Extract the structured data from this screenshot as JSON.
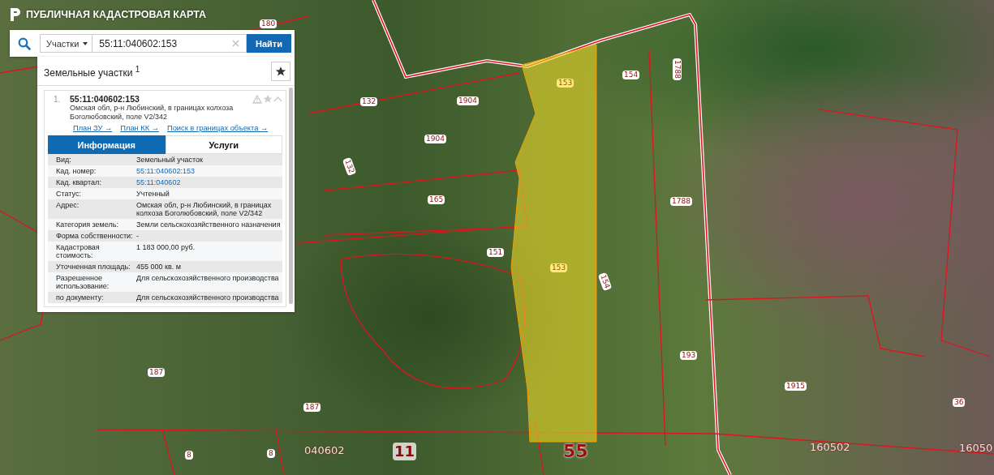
{
  "app_title": "ПУБЛИЧНАЯ КАДАСТРОВАЯ КАРТА",
  "search": {
    "category": "Участки",
    "value": "55:11:040602:153",
    "button": "Найти"
  },
  "results": {
    "title": "Земельные участки $^{1}$",
    "items": [
      {
        "index": "1.",
        "number": "55:11:040602:153",
        "address": "Омская обл, р-н Любинский, в границах колхоза Боголюбовский, поле V2/342",
        "links": [
          "План ЗУ →",
          "План КК →",
          "Поиск в границах объекта →"
        ],
        "tabs": [
          {
            "label": "Информация",
            "selected": true
          },
          {
            "label": "Услуги",
            "selected": false
          }
        ],
        "rows": [
          {
            "label": "Вид:",
            "value": "Земельный участок",
            "kind": "text"
          },
          {
            "label": "Кад. номер:",
            "value": "55:11:040602:153",
            "kind": "link"
          },
          {
            "label": "Кад. квартал:",
            "value": "55:11:040602",
            "kind": "link"
          },
          {
            "label": "Статус:",
            "value": "Учтенный",
            "kind": "text"
          },
          {
            "label": "Адрес:",
            "value": "Омская обл, р-н Любинский, в границах колхоза Боголюбовский, поле V2/342",
            "kind": "text"
          },
          {
            "label": "Категория земель:",
            "value": "Земли сельскохозяйственного назначения",
            "kind": "text"
          },
          {
            "label": "Форма собственности:",
            "value": "-",
            "kind": "text"
          },
          {
            "label": "Кадастровая стоимость:",
            "value": "1 183 000,00 руб.",
            "kind": "text"
          },
          {
            "label": "Уточненная площадь:",
            "value": "455 000 кв. м",
            "kind": "text"
          },
          {
            "label": "Разрешенное использование:",
            "value": "Для сельскохозяйственного производства",
            "kind": "text"
          },
          {
            "label": "по документу:",
            "value": "Для сельскохозяйственного производства",
            "kind": "text"
          }
        ]
      }
    ]
  },
  "map_labels": [
    {
      "text": "180",
      "kind": "parcel"
    },
    {
      "text": "153",
      "kind": "selected"
    },
    {
      "text": "154",
      "kind": "parcel"
    },
    {
      "text": "1788",
      "kind": "parcel"
    },
    {
      "text": "132",
      "kind": "parcel"
    },
    {
      "text": "1904",
      "kind": "parcel"
    },
    {
      "text": "1904",
      "kind": "parcel"
    },
    {
      "text": "132",
      "kind": "parcel"
    },
    {
      "text": "165",
      "kind": "parcel"
    },
    {
      "text": "1788",
      "kind": "parcel"
    },
    {
      "text": "151",
      "kind": "parcel"
    },
    {
      "text": "153",
      "kind": "selected"
    },
    {
      "text": "154",
      "kind": "parcel"
    },
    {
      "text": "193",
      "kind": "parcel"
    },
    {
      "text": "187",
      "kind": "parcel"
    },
    {
      "text": "187",
      "kind": "parcel"
    },
    {
      "text": "8",
      "kind": "parcel"
    },
    {
      "text": "8",
      "kind": "parcel"
    },
    {
      "text": "040602",
      "kind": "quarter"
    },
    {
      "text": "11",
      "kind": "district"
    },
    {
      "text": "55",
      "kind": "region"
    },
    {
      "text": "1915",
      "kind": "parcel"
    },
    {
      "text": "36",
      "kind": "parcel"
    },
    {
      "text": "160502",
      "kind": "quarter"
    },
    {
      "text": "16050",
      "kind": "quarter"
    }
  ]
}
